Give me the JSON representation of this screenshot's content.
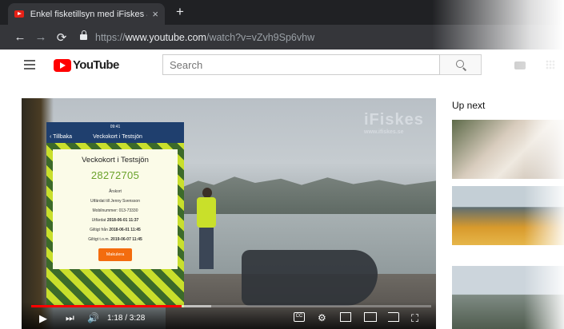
{
  "browser": {
    "tab_title": "Enkel fisketillsyn med iFiskes app",
    "tab_close": "×",
    "new_tab": "+",
    "url_prefix": "https://",
    "url_host": "www.youtube.com",
    "url_path": "/watch?v=vZvh9Sp6vhw"
  },
  "youtube": {
    "logo_text": "YouTube",
    "search_placeholder": "Search"
  },
  "video": {
    "watermark": "iFiskes",
    "watermark_sub": "www.ifiskes.se",
    "current_time": "1:18",
    "duration": "3:28",
    "time_display": "1:18 / 3:28",
    "progress_fraction": 0.375,
    "buffered_fraction": 0.45,
    "phone": {
      "status_time": "09:41",
      "back_label": "Tillbaka",
      "screen_title": "Veckokort i Testsjön",
      "card_title": "Veckokort i Testsjön",
      "card_number": "28272705",
      "lines": [
        {
          "label": "Årskort",
          "value": ""
        },
        {
          "label": "Utfärdat till Jenny Svensson",
          "value": ""
        },
        {
          "label": "Mobilnummer: 013-73330",
          "value": ""
        },
        {
          "label": "Utfärdat ",
          "value": "2018-06-01 11:37"
        },
        {
          "label": "Giltigt från ",
          "value": "2018-06-01 11:45"
        },
        {
          "label": "Giltigt t.o.m. ",
          "value": "2019-06-07 11:45"
        }
      ],
      "button_label": "Makulera"
    }
  },
  "sidebar": {
    "heading": "Up next"
  },
  "colors": {
    "youtube_red": "#ff0000",
    "vest_yellow": "#c9e02a",
    "button_orange": "#f36c0e",
    "card_number_green": "#6aa22a"
  }
}
